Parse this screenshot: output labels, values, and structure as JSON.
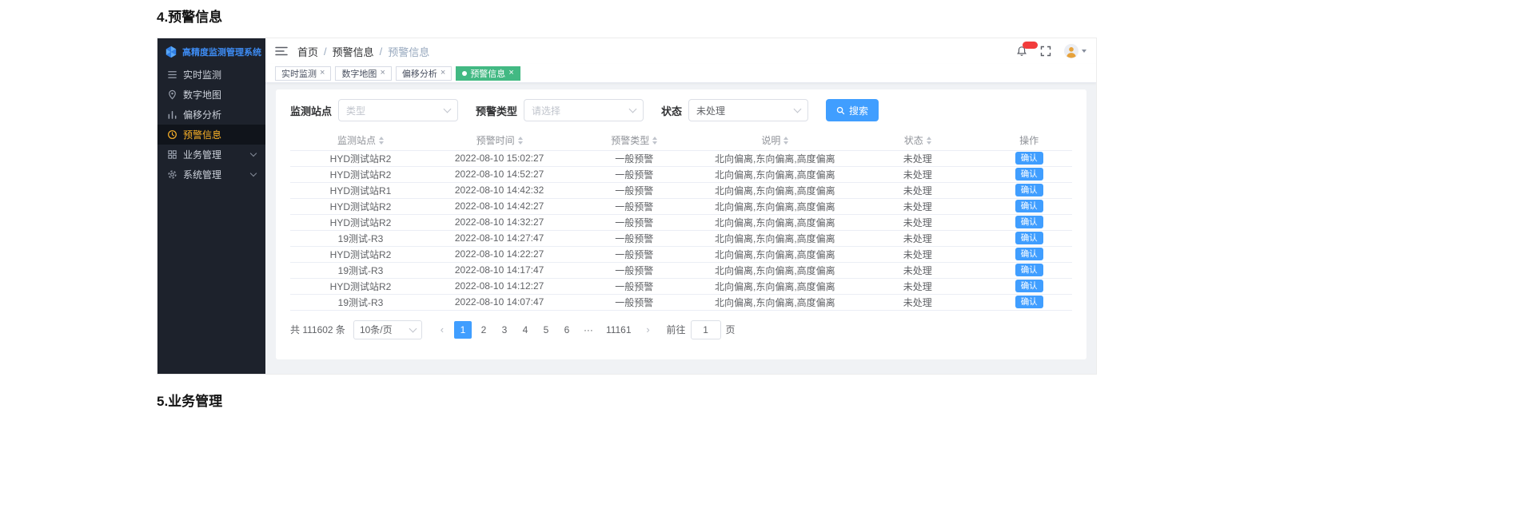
{
  "page": {
    "heading_top": "4.预警信息",
    "heading_bottom": "5.业务管理"
  },
  "colors": {
    "accent": "#409eff",
    "active_tag_green": "#42b983",
    "sidebar_bg": "#1d222c",
    "active_menu_text": "#fcb228",
    "badge_red": "#f23c3c"
  },
  "icons": {
    "logo": "pinwheel-hexagon",
    "hamburger": "menu-lines",
    "bell": "notification-bell",
    "fullscreen": "expand-corners",
    "avatar": "user-person",
    "search": "magnifier"
  },
  "sidebar": {
    "logo_title": "高精度监测管理系统",
    "items": [
      {
        "label": "实时监测"
      },
      {
        "label": "数字地图"
      },
      {
        "label": "偏移分析"
      },
      {
        "label": "预警信息"
      },
      {
        "label": "业务管理"
      },
      {
        "label": "系统管理"
      }
    ]
  },
  "header": {
    "breadcrumb": [
      "首页",
      "预警信息",
      "预警信息"
    ],
    "separator": "/"
  },
  "tags": [
    {
      "label": "实时监测"
    },
    {
      "label": "数字地图"
    },
    {
      "label": "偏移分析"
    },
    {
      "label": "预警信息"
    }
  ],
  "tag_close_glyph": "×",
  "filters": {
    "station_label": "监测站点",
    "station_placeholder": "类型",
    "type_label": "预警类型",
    "type_placeholder": "请选择",
    "status_label": "状态",
    "status_value": "未处理",
    "search_label": "搜索"
  },
  "table": {
    "columns": [
      "监测站点",
      "预警时间",
      "预警类型",
      "说明",
      "状态",
      "操作"
    ],
    "confirm_label": "确认",
    "rows": [
      {
        "station": "HYD测试站R2",
        "time": "2022-08-10 15:02:27",
        "type": "一般预警",
        "desc": "北向偏离,东向偏离,高度偏离",
        "status": "未处理"
      },
      {
        "station": "HYD测试站R2",
        "time": "2022-08-10 14:52:27",
        "type": "一般预警",
        "desc": "北向偏离,东向偏离,高度偏离",
        "status": "未处理"
      },
      {
        "station": "HYD测试站R1",
        "time": "2022-08-10 14:42:32",
        "type": "一般预警",
        "desc": "北向偏离,东向偏离,高度偏离",
        "status": "未处理"
      },
      {
        "station": "HYD测试站R2",
        "time": "2022-08-10 14:42:27",
        "type": "一般预警",
        "desc": "北向偏离,东向偏离,高度偏离",
        "status": "未处理"
      },
      {
        "station": "HYD测试站R2",
        "time": "2022-08-10 14:32:27",
        "type": "一般预警",
        "desc": "北向偏离,东向偏离,高度偏离",
        "status": "未处理"
      },
      {
        "station": "19测试-R3",
        "time": "2022-08-10 14:27:47",
        "type": "一般预警",
        "desc": "北向偏离,东向偏离,高度偏离",
        "status": "未处理"
      },
      {
        "station": "HYD测试站R2",
        "time": "2022-08-10 14:22:27",
        "type": "一般预警",
        "desc": "北向偏离,东向偏离,高度偏离",
        "status": "未处理"
      },
      {
        "station": "19测试-R3",
        "time": "2022-08-10 14:17:47",
        "type": "一般预警",
        "desc": "北向偏离,东向偏离,高度偏离",
        "status": "未处理"
      },
      {
        "station": "HYD测试站R2",
        "time": "2022-08-10 14:12:27",
        "type": "一般预警",
        "desc": "北向偏离,东向偏离,高度偏离",
        "status": "未处理"
      },
      {
        "station": "19测试-R3",
        "time": "2022-08-10 14:07:47",
        "type": "一般预警",
        "desc": "北向偏离,东向偏离,高度偏离",
        "status": "未处理"
      }
    ]
  },
  "pagination": {
    "total": "共 111602 条",
    "page_size": "10条/页",
    "prev_glyph": "‹",
    "next_glyph": "›",
    "pages": [
      "1",
      "2",
      "3",
      "4",
      "5",
      "6"
    ],
    "ellipsis": "···",
    "last_page": "11161",
    "goto_label": "前往",
    "goto_value": "1",
    "goto_suffix": "页"
  }
}
